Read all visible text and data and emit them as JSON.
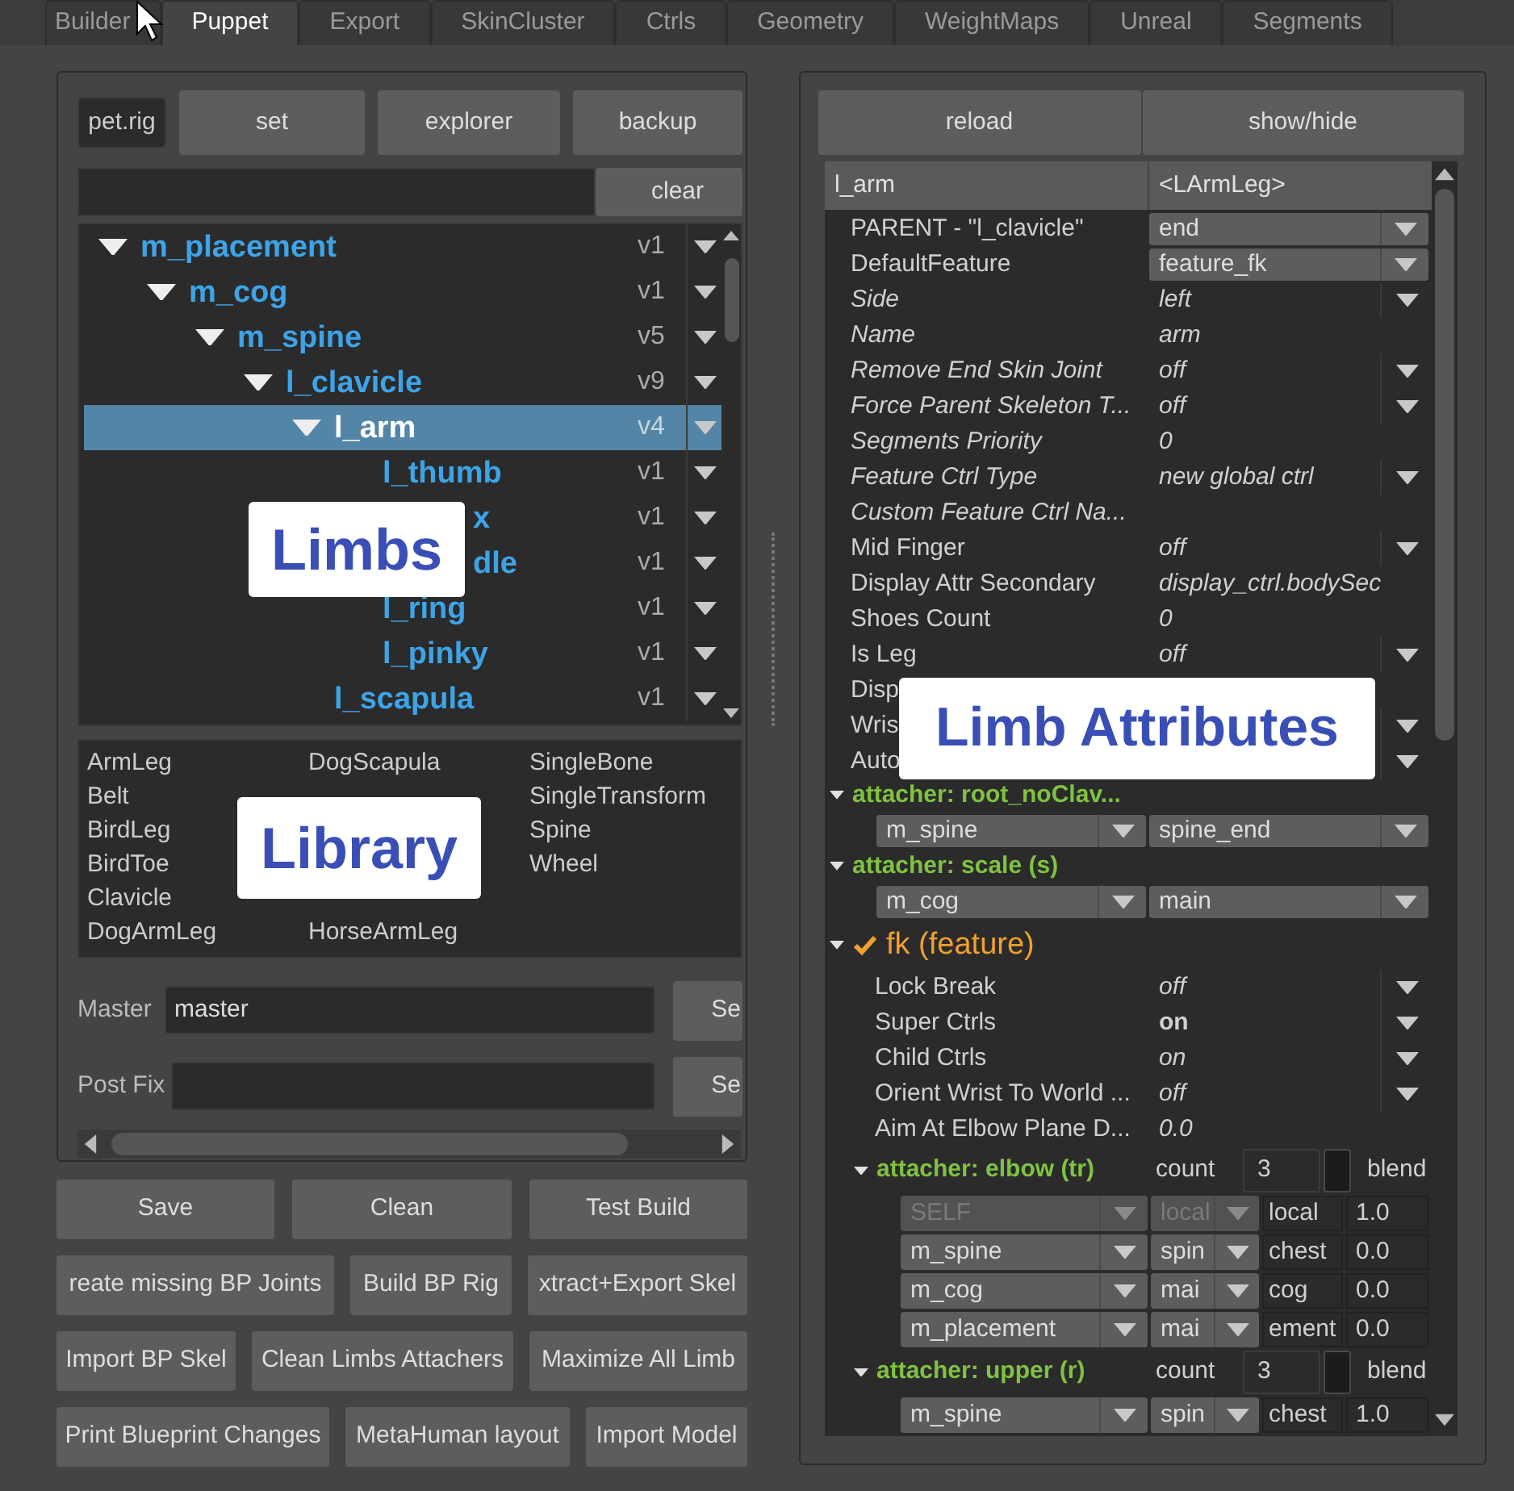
{
  "tabs": [
    {
      "label": "Builder",
      "selected": false
    },
    {
      "label": "Puppet",
      "selected": true
    },
    {
      "label": "Export",
      "selected": false
    },
    {
      "label": "SkinCluster",
      "selected": false
    },
    {
      "label": "Ctrls",
      "selected": false
    },
    {
      "label": "Geometry",
      "selected": false
    },
    {
      "label": "WeightMaps",
      "selected": false
    },
    {
      "label": "Unreal",
      "selected": false
    },
    {
      "label": "Segments",
      "selected": false
    }
  ],
  "left_panel": {
    "rig_field": {
      "value": "pet.rig"
    },
    "top_buttons": [
      "set",
      "explorer",
      "backup"
    ],
    "search": {
      "button": "clear"
    },
    "limbs": {
      "callout": "Limbs",
      "items": [
        {
          "label": "m_placement",
          "version": "v1",
          "kind": "node",
          "expanded": true,
          "selected": false,
          "children": [
            {
              "label": "m_cog",
              "version": "v1",
              "kind": "node",
              "expanded": true,
              "selected": false,
              "children": [
                {
                  "label": "m_spine",
                  "version": "v5",
                  "kind": "node",
                  "expanded": true,
                  "selected": false,
                  "children": [
                    {
                      "label": "l_clavicle",
                      "version": "v9",
                      "kind": "node",
                      "expanded": true,
                      "selected": false,
                      "children": [
                        {
                          "label": "l_arm",
                          "version": "v4",
                          "kind": "node",
                          "expanded": true,
                          "selected": true,
                          "children": [
                            {
                              "label": "l_thumb",
                              "version": "v1",
                              "kind": "node",
                              "selected": false
                            },
                            {
                              "label": "x",
                              "version": "v1",
                              "kind": "covered",
                              "selected": false
                            },
                            {
                              "label": "dle",
                              "version": "v1",
                              "kind": "covered",
                              "selected": false
                            },
                            {
                              "label": "l_ring",
                              "version": "v1",
                              "kind": "node",
                              "selected": false
                            },
                            {
                              "label": "l_pinky",
                              "version": "v1",
                              "kind": "node",
                              "selected": false
                            }
                          ]
                        },
                        {
                          "label": "l_scapula",
                          "version": "v1",
                          "kind": "node",
                          "selected": false
                        }
                      ]
                    }
                  ]
                }
              ]
            }
          ]
        }
      ]
    },
    "library": {
      "callout": "Library",
      "columns": [
        {
          "top": [
            "ArmLeg",
            "Belt",
            "BirdLeg",
            "BirdToe",
            "Clavicle",
            "DogArmLeg"
          ]
        },
        {
          "top": [
            "DogScapula"
          ],
          "bottom": [
            "HorseArmLeg"
          ]
        },
        {
          "top": [
            "SingleBone",
            "SingleTransform",
            "Spine",
            "Wheel"
          ]
        }
      ]
    },
    "fields": [
      {
        "label": "Master",
        "value": "master",
        "button": "Se"
      },
      {
        "label": "Post Fix",
        "button": "Se"
      }
    ]
  },
  "action_rows": [
    [
      "Save",
      "Clean",
      "Test Build"
    ],
    [
      "reate missing BP Joints",
      "Build BP Rig",
      "xtract+Export Skel"
    ],
    [
      "Import BP Skel",
      "Clean Limbs Attachers",
      "Maximize All Limb"
    ],
    [
      "Print Blueprint Changes",
      "MetaHuman layout",
      "Import Model"
    ]
  ],
  "right_panel": {
    "buttons": [
      "reload",
      "show/hide"
    ],
    "header": {
      "name": "l_arm",
      "type": "<LArmLeg>"
    },
    "callout": "Limb Attributes",
    "attributes": [
      {
        "kind": "combo",
        "label": "PARENT - \"l_clavicle\"",
        "italic": false,
        "value": "end"
      },
      {
        "kind": "combo",
        "label": "DefaultFeature",
        "italic": false,
        "value": "feature_fk"
      },
      {
        "kind": "enum",
        "label": "Side",
        "italic": true,
        "value": "left",
        "value_italic": true
      },
      {
        "kind": "value",
        "label": "Name",
        "italic": true,
        "value": "arm",
        "value_italic": true
      },
      {
        "kind": "enum",
        "label": "Remove End Skin Joint",
        "italic": true,
        "value": "off",
        "value_italic": true
      },
      {
        "kind": "enum",
        "label": "Force Parent Skeleton T...",
        "italic": true,
        "value": "off",
        "value_italic": true
      },
      {
        "kind": "value",
        "label": "Segments Priority",
        "italic": true,
        "value": "0",
        "value_italic": true
      },
      {
        "kind": "enum",
        "label": "Feature Ctrl Type",
        "italic": true,
        "value": "new global ctrl",
        "value_italic": true
      },
      {
        "kind": "label",
        "label": "Custom Feature Ctrl Na...",
        "italic": true
      },
      {
        "kind": "enum",
        "label": "Mid Finger",
        "italic": false,
        "value": "off",
        "value_italic": true
      },
      {
        "kind": "value",
        "label": "Display Attr Secondary",
        "italic": false,
        "value": "display_ctrl.bodySec",
        "value_italic": true
      },
      {
        "kind": "value",
        "label": "Shoes Count",
        "italic": false,
        "value": "0",
        "value_italic": true
      },
      {
        "kind": "enum",
        "label": "Is Leg",
        "italic": false,
        "value": "off",
        "value_italic": true
      },
      {
        "kind": "label",
        "label": "Disp",
        "italic": false
      },
      {
        "kind": "enum",
        "label": "Wris",
        "italic": false
      },
      {
        "kind": "enum",
        "label": "Auto",
        "italic": false
      }
    ],
    "sections": [
      {
        "kind": "attacher",
        "title": "attacher: root_noClav...",
        "expanded": true,
        "targets": [
          "m_spine",
          "spine_end"
        ]
      },
      {
        "kind": "attacher",
        "title": "attacher: scale (s)",
        "expanded": true,
        "targets": [
          "m_cog",
          "main"
        ]
      },
      {
        "kind": "feature",
        "title": "fk (feature)",
        "expanded": true,
        "checked": true,
        "rows": [
          {
            "kind": "enum",
            "label": "Lock Break",
            "value": "off",
            "value_italic": true,
            "value_bold": false
          },
          {
            "kind": "enum",
            "label": "Super Ctrls",
            "value": "on",
            "value_italic": false,
            "value_bold": true
          },
          {
            "kind": "enum",
            "label": "Child Ctrls",
            "value": "on",
            "value_italic": true,
            "value_bold": false
          },
          {
            "kind": "enum",
            "label": "Orient Wrist To World ...",
            "value": "off",
            "value_italic": true,
            "value_bold": false
          },
          {
            "kind": "value",
            "label": "Aim At Elbow Plane D...",
            "value": "0.0",
            "value_italic": true,
            "value_bold": false
          }
        ]
      },
      {
        "kind": "blend",
        "title": "attacher: elbow (tr)",
        "expanded": true,
        "count_label": "count",
        "count": "3",
        "blend_checked": false,
        "blend_label": "blend",
        "rows": [
          {
            "target": "SELF",
            "attr": "local",
            "name": "local",
            "weight": "1.0",
            "disabled": true
          },
          {
            "target": "m_spine",
            "attr": "spin",
            "name": "chest",
            "weight": "0.0",
            "disabled": false
          },
          {
            "target": "m_cog",
            "attr": "mai",
            "name": "cog",
            "weight": "0.0",
            "disabled": false
          },
          {
            "target": "m_placement",
            "attr": "mai",
            "name": "ement",
            "weight": "0.0",
            "disabled": false
          }
        ]
      },
      {
        "kind": "blend",
        "title": "attacher: upper (r)",
        "expanded": true,
        "count_label": "count",
        "count": "3",
        "blend_checked": false,
        "blend_label": "blend",
        "rows": [
          {
            "target": "m_spine",
            "attr": "spin",
            "name": "chest",
            "weight": "1.0",
            "disabled": false
          }
        ]
      }
    ]
  }
}
